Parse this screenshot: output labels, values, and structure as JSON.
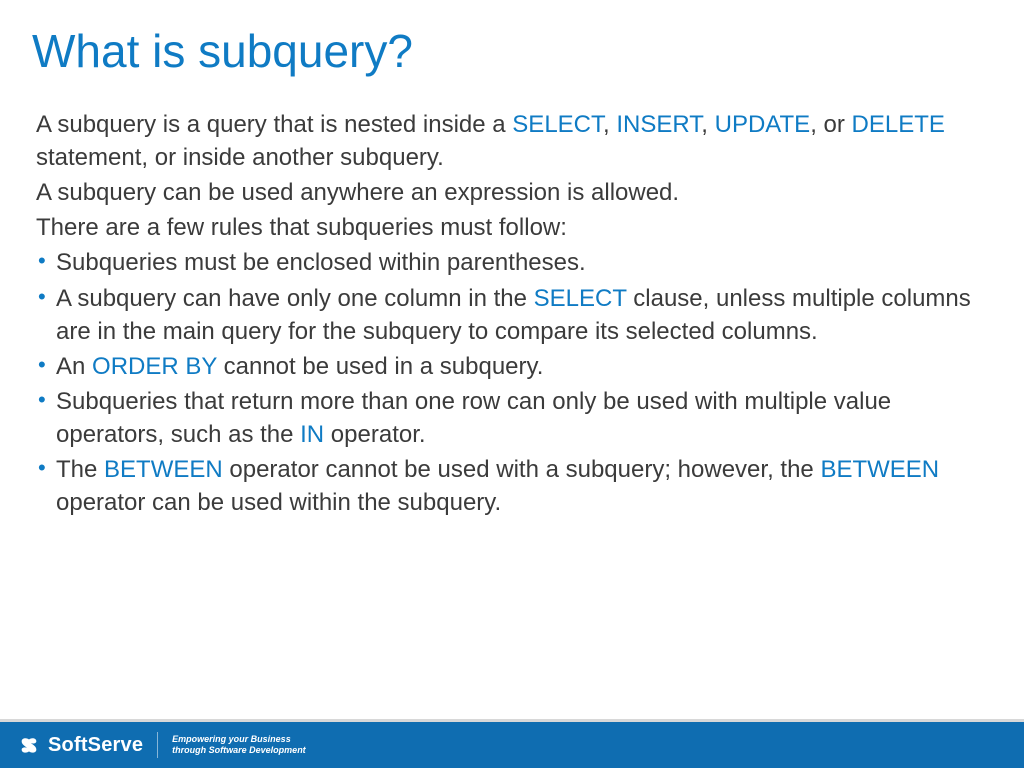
{
  "title": "What is subquery?",
  "intro": {
    "p1_pre": "A subquery is a query that is nested inside a ",
    "kw_select": "SELECT",
    "sep1": ", ",
    "kw_insert": "INSERT",
    "sep2": ", ",
    "kw_update": "UPDATE",
    "sep3": ", or ",
    "kw_delete": "DELETE",
    "p1_post": " statement, or inside another subquery.",
    "p2": "A subquery can be used anywhere an expression is allowed.",
    "p3": "There are a few rules that subqueries must follow:"
  },
  "bullets": {
    "b1": "Subqueries must be enclosed within parentheses.",
    "b2_pre": "A subquery can have only one column in the ",
    "b2_kw": "SELECT",
    "b2_post": " clause, unless multiple columns are in the main query for the subquery to compare its selected columns.",
    "b3_pre": "An ",
    "b3_kw": "ORDER BY",
    "b3_post": " cannot be used in a subquery.",
    "b4_pre": "Subqueries that return more than one row can only be used with multiple value operators, such as the ",
    "b4_kw": "IN",
    "b4_post": " operator.",
    "b5_pre": "The ",
    "b5_kw1": "BETWEEN",
    "b5_mid": " operator cannot be used with a subquery; however, the ",
    "b5_kw2": "BETWEEN",
    "b5_post": " operator can be used within the subquery."
  },
  "footer": {
    "brand": "SoftServe",
    "tagline1": "Empowering your Business",
    "tagline2": "through Software Development"
  }
}
